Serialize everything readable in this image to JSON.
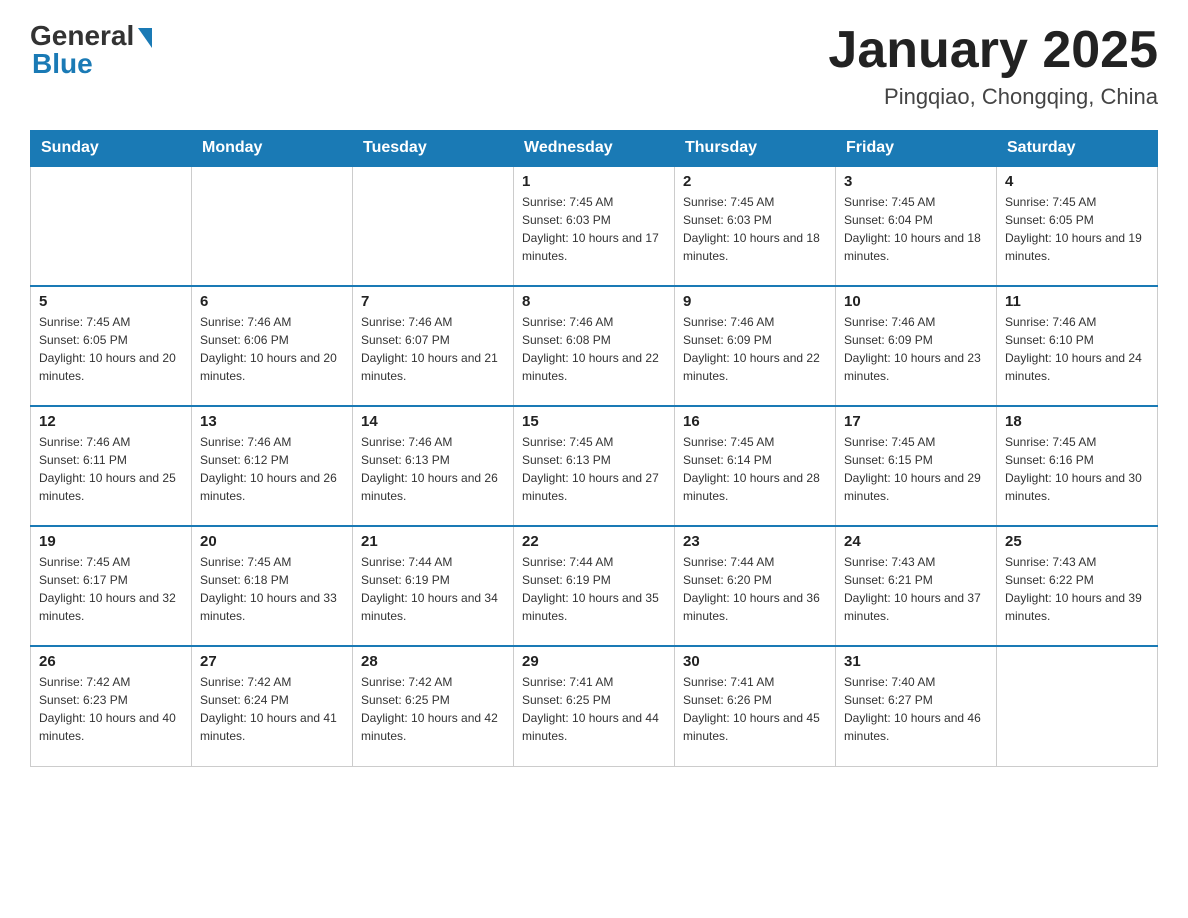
{
  "header": {
    "logo_general": "General",
    "logo_blue": "Blue",
    "month_title": "January 2025",
    "location": "Pingqiao, Chongqing, China"
  },
  "weekdays": [
    "Sunday",
    "Monday",
    "Tuesday",
    "Wednesday",
    "Thursday",
    "Friday",
    "Saturday"
  ],
  "weeks": [
    [
      {
        "day": "",
        "sunrise": "",
        "sunset": "",
        "daylight": ""
      },
      {
        "day": "",
        "sunrise": "",
        "sunset": "",
        "daylight": ""
      },
      {
        "day": "",
        "sunrise": "",
        "sunset": "",
        "daylight": ""
      },
      {
        "day": "1",
        "sunrise": "Sunrise: 7:45 AM",
        "sunset": "Sunset: 6:03 PM",
        "daylight": "Daylight: 10 hours and 17 minutes."
      },
      {
        "day": "2",
        "sunrise": "Sunrise: 7:45 AM",
        "sunset": "Sunset: 6:03 PM",
        "daylight": "Daylight: 10 hours and 18 minutes."
      },
      {
        "day": "3",
        "sunrise": "Sunrise: 7:45 AM",
        "sunset": "Sunset: 6:04 PM",
        "daylight": "Daylight: 10 hours and 18 minutes."
      },
      {
        "day": "4",
        "sunrise": "Sunrise: 7:45 AM",
        "sunset": "Sunset: 6:05 PM",
        "daylight": "Daylight: 10 hours and 19 minutes."
      }
    ],
    [
      {
        "day": "5",
        "sunrise": "Sunrise: 7:45 AM",
        "sunset": "Sunset: 6:05 PM",
        "daylight": "Daylight: 10 hours and 20 minutes."
      },
      {
        "day": "6",
        "sunrise": "Sunrise: 7:46 AM",
        "sunset": "Sunset: 6:06 PM",
        "daylight": "Daylight: 10 hours and 20 minutes."
      },
      {
        "day": "7",
        "sunrise": "Sunrise: 7:46 AM",
        "sunset": "Sunset: 6:07 PM",
        "daylight": "Daylight: 10 hours and 21 minutes."
      },
      {
        "day": "8",
        "sunrise": "Sunrise: 7:46 AM",
        "sunset": "Sunset: 6:08 PM",
        "daylight": "Daylight: 10 hours and 22 minutes."
      },
      {
        "day": "9",
        "sunrise": "Sunrise: 7:46 AM",
        "sunset": "Sunset: 6:09 PM",
        "daylight": "Daylight: 10 hours and 22 minutes."
      },
      {
        "day": "10",
        "sunrise": "Sunrise: 7:46 AM",
        "sunset": "Sunset: 6:09 PM",
        "daylight": "Daylight: 10 hours and 23 minutes."
      },
      {
        "day": "11",
        "sunrise": "Sunrise: 7:46 AM",
        "sunset": "Sunset: 6:10 PM",
        "daylight": "Daylight: 10 hours and 24 minutes."
      }
    ],
    [
      {
        "day": "12",
        "sunrise": "Sunrise: 7:46 AM",
        "sunset": "Sunset: 6:11 PM",
        "daylight": "Daylight: 10 hours and 25 minutes."
      },
      {
        "day": "13",
        "sunrise": "Sunrise: 7:46 AM",
        "sunset": "Sunset: 6:12 PM",
        "daylight": "Daylight: 10 hours and 26 minutes."
      },
      {
        "day": "14",
        "sunrise": "Sunrise: 7:46 AM",
        "sunset": "Sunset: 6:13 PM",
        "daylight": "Daylight: 10 hours and 26 minutes."
      },
      {
        "day": "15",
        "sunrise": "Sunrise: 7:45 AM",
        "sunset": "Sunset: 6:13 PM",
        "daylight": "Daylight: 10 hours and 27 minutes."
      },
      {
        "day": "16",
        "sunrise": "Sunrise: 7:45 AM",
        "sunset": "Sunset: 6:14 PM",
        "daylight": "Daylight: 10 hours and 28 minutes."
      },
      {
        "day": "17",
        "sunrise": "Sunrise: 7:45 AM",
        "sunset": "Sunset: 6:15 PM",
        "daylight": "Daylight: 10 hours and 29 minutes."
      },
      {
        "day": "18",
        "sunrise": "Sunrise: 7:45 AM",
        "sunset": "Sunset: 6:16 PM",
        "daylight": "Daylight: 10 hours and 30 minutes."
      }
    ],
    [
      {
        "day": "19",
        "sunrise": "Sunrise: 7:45 AM",
        "sunset": "Sunset: 6:17 PM",
        "daylight": "Daylight: 10 hours and 32 minutes."
      },
      {
        "day": "20",
        "sunrise": "Sunrise: 7:45 AM",
        "sunset": "Sunset: 6:18 PM",
        "daylight": "Daylight: 10 hours and 33 minutes."
      },
      {
        "day": "21",
        "sunrise": "Sunrise: 7:44 AM",
        "sunset": "Sunset: 6:19 PM",
        "daylight": "Daylight: 10 hours and 34 minutes."
      },
      {
        "day": "22",
        "sunrise": "Sunrise: 7:44 AM",
        "sunset": "Sunset: 6:19 PM",
        "daylight": "Daylight: 10 hours and 35 minutes."
      },
      {
        "day": "23",
        "sunrise": "Sunrise: 7:44 AM",
        "sunset": "Sunset: 6:20 PM",
        "daylight": "Daylight: 10 hours and 36 minutes."
      },
      {
        "day": "24",
        "sunrise": "Sunrise: 7:43 AM",
        "sunset": "Sunset: 6:21 PM",
        "daylight": "Daylight: 10 hours and 37 minutes."
      },
      {
        "day": "25",
        "sunrise": "Sunrise: 7:43 AM",
        "sunset": "Sunset: 6:22 PM",
        "daylight": "Daylight: 10 hours and 39 minutes."
      }
    ],
    [
      {
        "day": "26",
        "sunrise": "Sunrise: 7:42 AM",
        "sunset": "Sunset: 6:23 PM",
        "daylight": "Daylight: 10 hours and 40 minutes."
      },
      {
        "day": "27",
        "sunrise": "Sunrise: 7:42 AM",
        "sunset": "Sunset: 6:24 PM",
        "daylight": "Daylight: 10 hours and 41 minutes."
      },
      {
        "day": "28",
        "sunrise": "Sunrise: 7:42 AM",
        "sunset": "Sunset: 6:25 PM",
        "daylight": "Daylight: 10 hours and 42 minutes."
      },
      {
        "day": "29",
        "sunrise": "Sunrise: 7:41 AM",
        "sunset": "Sunset: 6:25 PM",
        "daylight": "Daylight: 10 hours and 44 minutes."
      },
      {
        "day": "30",
        "sunrise": "Sunrise: 7:41 AM",
        "sunset": "Sunset: 6:26 PM",
        "daylight": "Daylight: 10 hours and 45 minutes."
      },
      {
        "day": "31",
        "sunrise": "Sunrise: 7:40 AM",
        "sunset": "Sunset: 6:27 PM",
        "daylight": "Daylight: 10 hours and 46 minutes."
      },
      {
        "day": "",
        "sunrise": "",
        "sunset": "",
        "daylight": ""
      }
    ]
  ]
}
